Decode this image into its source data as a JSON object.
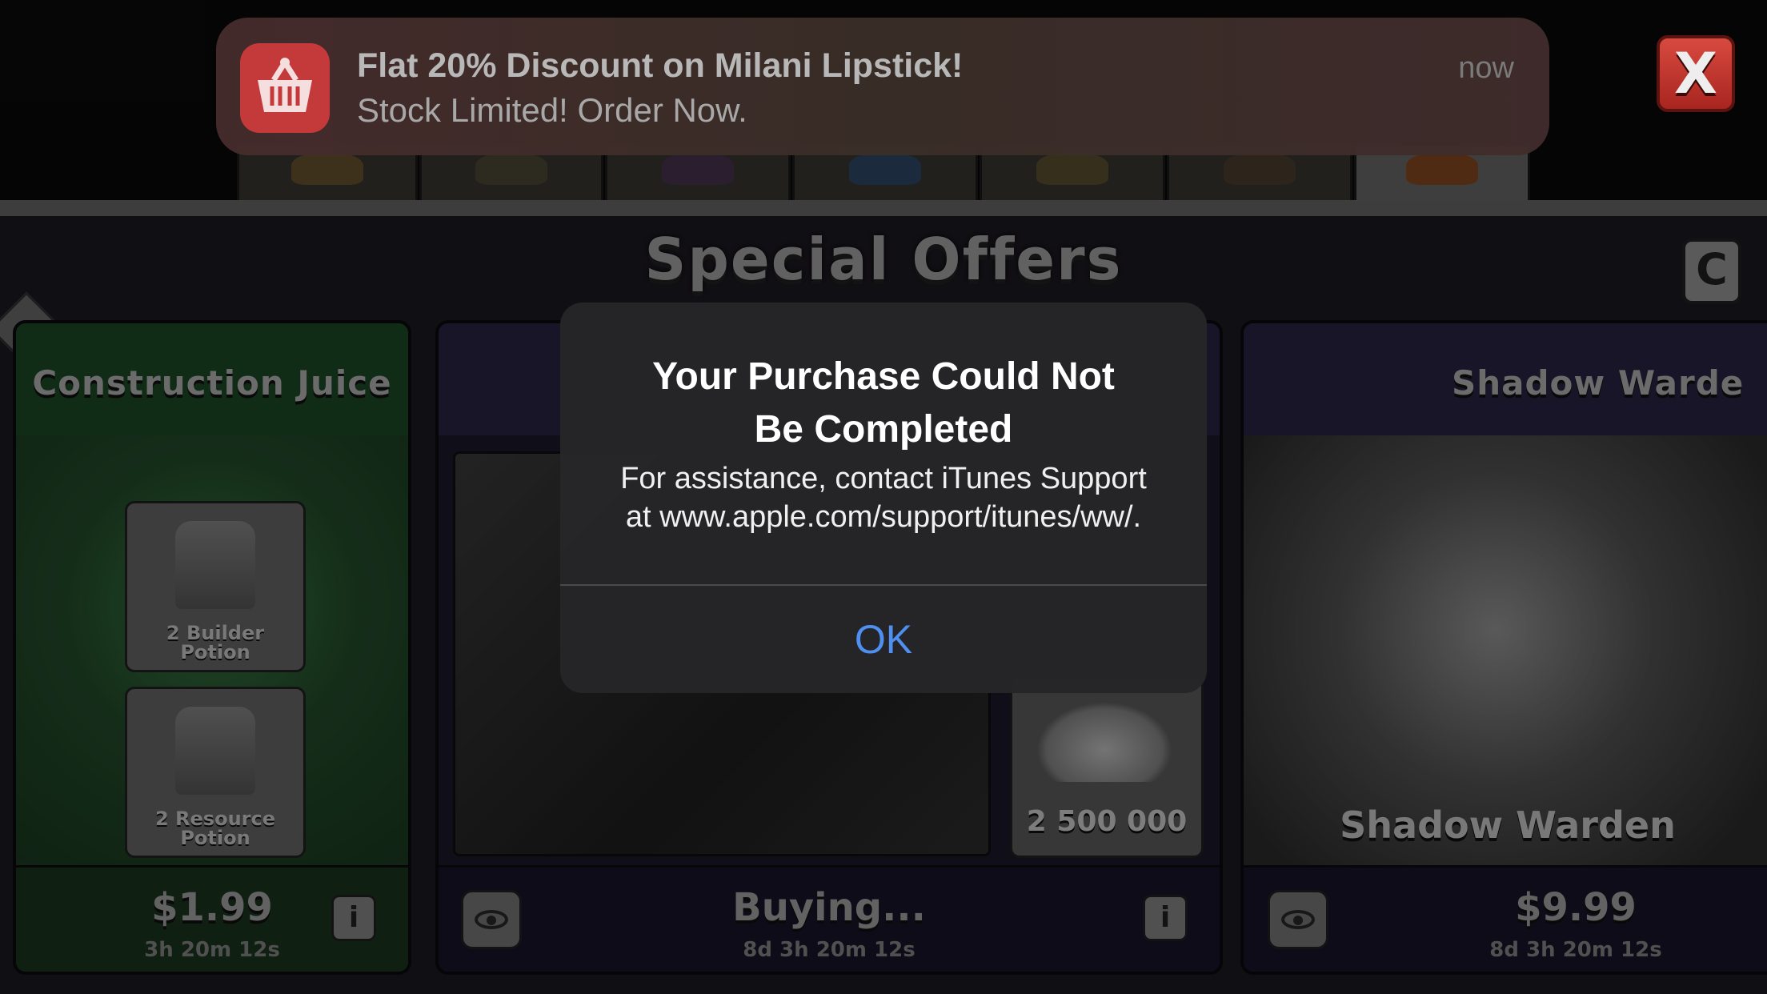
{
  "notification": {
    "app_icon": "shopping-basket-icon",
    "title": "Flat 20% Discount on Milani Lipstick!",
    "body": "Stock Limited! Order Now.",
    "time": "now"
  },
  "close_button": {
    "label": "X"
  },
  "shop": {
    "title": "Special Offers",
    "corner_button": "C",
    "cards": [
      {
        "title": "Construction Juice",
        "items": [
          "2 Builder\nPotion",
          "2 Resource\nPotion"
        ],
        "price": "$1.99",
        "timer": "3h 20m 12s"
      },
      {
        "gold_amount": "2 500 000",
        "status": "Buying...",
        "timer": "8d 3h 20m 12s"
      },
      {
        "title": "Shadow Warde",
        "hero_name": "Shadow Warden",
        "price": "$9.99",
        "timer": "8d 3h 20m 12s"
      }
    ]
  },
  "alert": {
    "title": "Your Purchase Could Not\nBe Completed",
    "message": "For assistance, contact iTunes Support\nat www.apple.com/support/itunes/ww/.",
    "ok_label": "OK"
  },
  "colors": {
    "alert_bg": "#262628",
    "alert_button": "#4f8ff2",
    "close_button": "#c03028"
  }
}
